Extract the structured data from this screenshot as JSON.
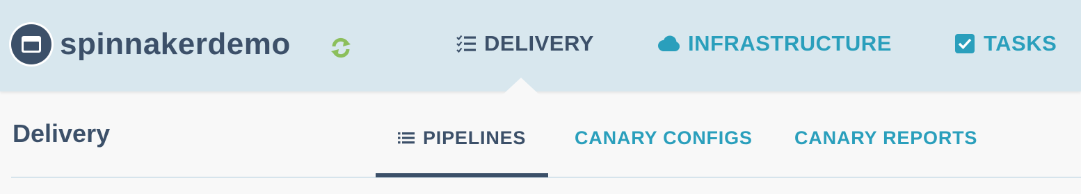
{
  "header": {
    "app_name": "spinnakerdemo",
    "nav": [
      {
        "label": "DELIVERY",
        "icon": "checklist-icon",
        "active": true
      },
      {
        "label": "INFRASTRUCTURE",
        "icon": "cloud-icon",
        "active": false
      },
      {
        "label": "TASKS",
        "icon": "checkbox-icon",
        "active": false
      }
    ]
  },
  "section": {
    "title": "Delivery",
    "tabs": [
      {
        "label": "PIPELINES",
        "icon": "list-icon",
        "active": true
      },
      {
        "label": "CANARY CONFIGS",
        "active": false
      },
      {
        "label": "CANARY REPORTS",
        "active": false
      }
    ]
  },
  "colors": {
    "header_bg": "#d8e7ee",
    "primary_dark": "#3c5069",
    "link": "#2a9fbc",
    "refresh_green": "#8cbf5c"
  }
}
